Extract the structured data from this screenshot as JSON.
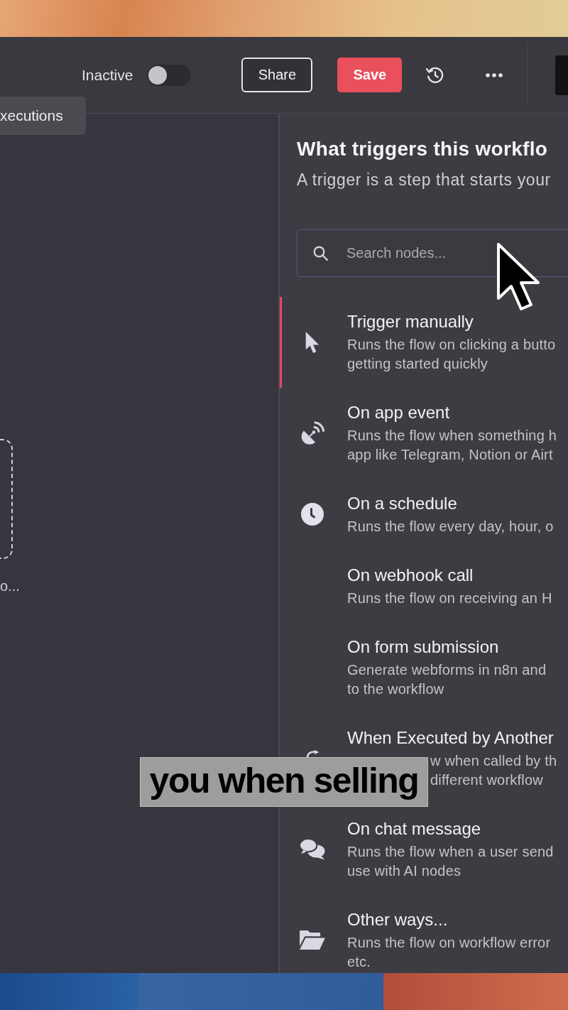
{
  "header": {
    "toggle": {
      "label": "Inactive",
      "on": false
    },
    "share_button": {
      "label": "Share"
    },
    "save_button": {
      "label": "Save"
    }
  },
  "tab": {
    "label": "xecutions"
  },
  "canvas": {
    "node_label": "o..."
  },
  "panel": {
    "title": "What triggers this workflo",
    "subtitle": "A trigger is a step that starts your",
    "search": {
      "placeholder": "Search nodes..."
    },
    "items": [
      {
        "kind": "standard",
        "selected": true,
        "title": "Trigger manually",
        "description": [
          "Runs the flow on clicking a butto",
          "getting started quickly"
        ]
      },
      {
        "kind": "standard",
        "selected": false,
        "title": "On app event",
        "description": [
          "Runs the flow when something h",
          "app like Telegram, Notion or Airt"
        ]
      },
      {
        "kind": "standard",
        "selected": false,
        "title": "On a schedule",
        "description": [
          "Runs the flow every day, hour, o"
        ]
      },
      {
        "kind": "standard",
        "selected": false,
        "title": "On webhook call",
        "description": [
          "Runs the flow on receiving an H"
        ]
      },
      {
        "kind": "standard",
        "selected": false,
        "title": "On form submission",
        "description": [
          "Generate webforms in n8n and",
          "to the workflow"
        ]
      },
      {
        "kind": "covered",
        "selected": false,
        "title": "When Executed by Another",
        "description": [
          "w when called by th",
          "different workflow"
        ]
      },
      {
        "kind": "standard",
        "selected": false,
        "title": "On chat message",
        "description": [
          "Runs the flow when a user send",
          "use with AI nodes"
        ]
      },
      {
        "kind": "standard",
        "selected": false,
        "title": "Other ways...",
        "description": [
          "Runs the flow on workflow error",
          "etc."
        ]
      }
    ]
  },
  "caption": {
    "text": "you when selling"
  }
}
